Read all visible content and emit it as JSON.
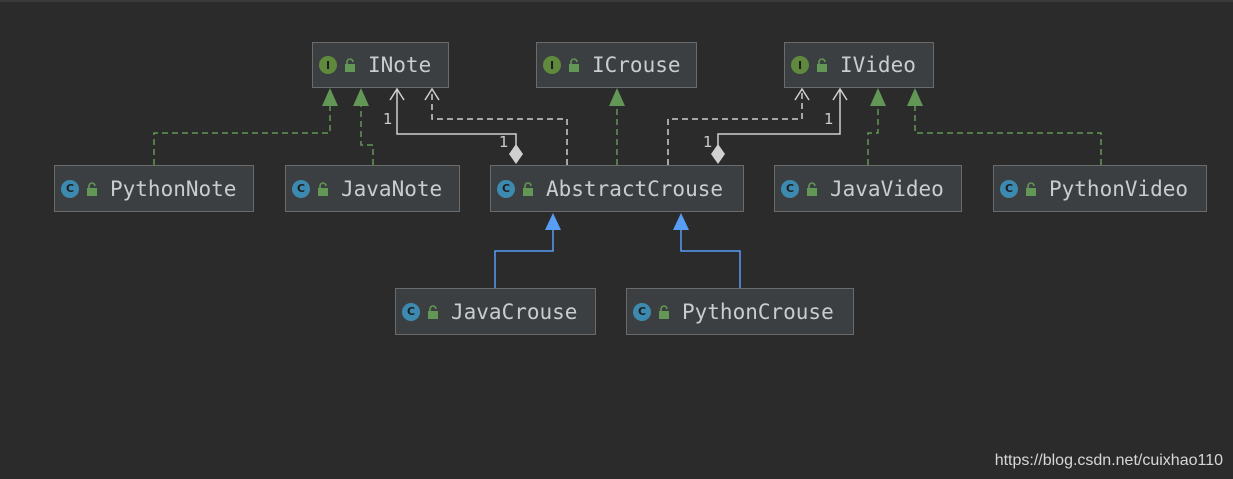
{
  "nodes": {
    "inote": {
      "name": "INote",
      "kind_letter": "I"
    },
    "icrouse": {
      "name": "ICrouse",
      "kind_letter": "I"
    },
    "ivideo": {
      "name": "IVideo",
      "kind_letter": "I"
    },
    "python_note": {
      "name": "PythonNote",
      "kind_letter": "C"
    },
    "java_note": {
      "name": "JavaNote",
      "kind_letter": "C"
    },
    "abstract_crouse": {
      "name": "AbstractCrouse",
      "kind_letter": "C"
    },
    "java_video": {
      "name": "JavaVideo",
      "kind_letter": "C"
    },
    "python_video": {
      "name": "PythonVideo",
      "kind_letter": "C"
    },
    "java_crouse": {
      "name": "JavaCrouse",
      "kind_letter": "C"
    },
    "python_crouse": {
      "name": "PythonCrouse",
      "kind_letter": "C"
    }
  },
  "multiplicities": {
    "inote_target": "1",
    "inote_source": "1",
    "ivideo_target": "1",
    "ivideo_source": "1"
  },
  "colors": {
    "realization": "#629755",
    "inheritance": "#589df6",
    "association": "#d0d0d0"
  },
  "watermark": "https://blog.csdn.net/cuixhao110"
}
